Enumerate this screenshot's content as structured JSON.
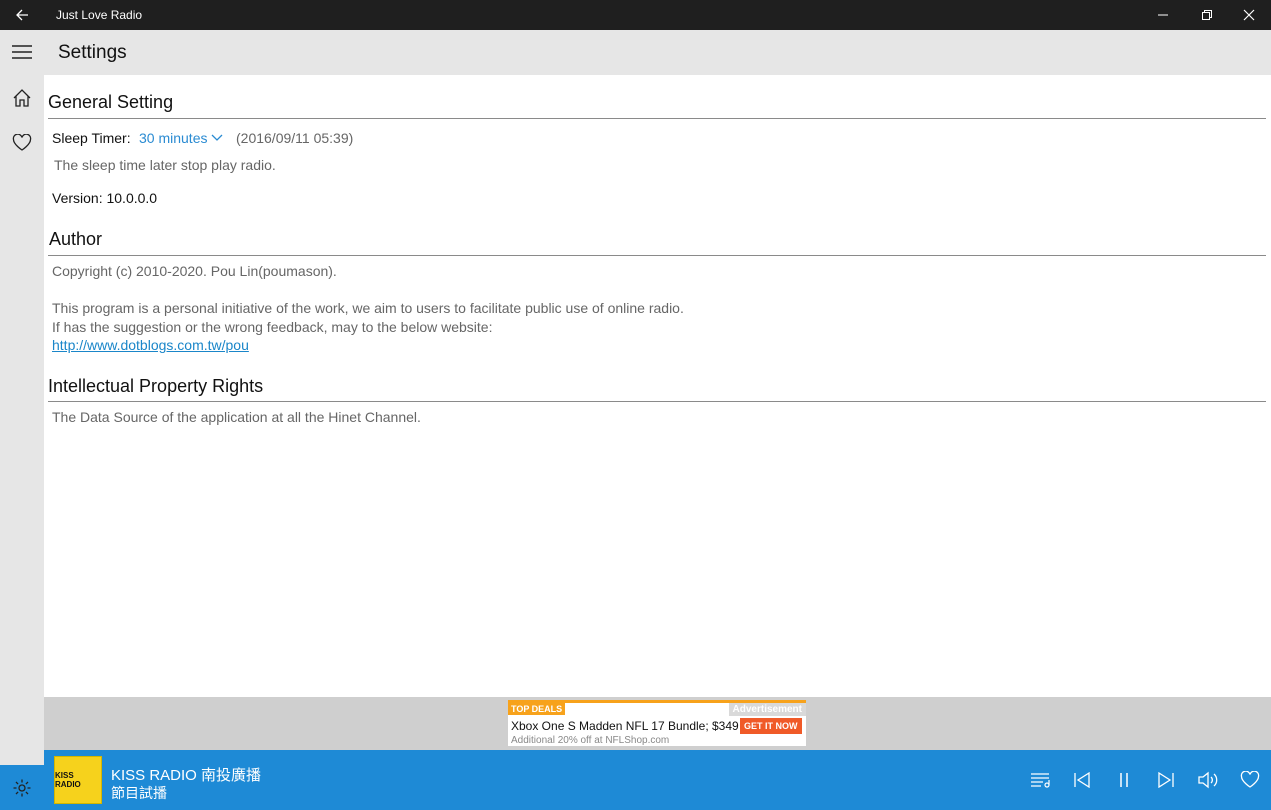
{
  "window": {
    "title": "Just Love Radio"
  },
  "header": {
    "title": "Settings"
  },
  "general": {
    "title": "General Setting",
    "sleep_label": "Sleep Timer:",
    "sleep_value": "30 minutes",
    "sleep_time": "(2016/09/11 05:39)",
    "sleep_desc": "The sleep time later stop play radio.",
    "version": "Version: 10.0.0.0"
  },
  "author": {
    "title": "Author",
    "copyright": "Copyright (c) 2010-2020. Pou Lin(poumason).",
    "line1": "This program is a personal initiative of the work, we aim to users to facilitate public use of online radio.",
    "line2": "If has the suggestion or the wrong feedback, may to the below website:",
    "link": "http://www.dotblogs.com.tw/pou"
  },
  "ipr": {
    "title": "Intellectual Property Rights",
    "text": "The Data Source of the application at all the Hinet Channel."
  },
  "ad": {
    "tag": "TOP DEALS",
    "label": "Advertisement",
    "headline": "Xbox One S Madden NFL 17 Bundle; $349",
    "cta": "GET IT NOW",
    "sub": "Additional 20% off at NFLShop.com"
  },
  "player": {
    "logo_text": "KISS RADIO",
    "station": "KISS RADIO 南投廣播",
    "program": "節目試播"
  },
  "icons": {
    "back": "back-arrow-icon",
    "minimize": "minimize-icon",
    "restore": "restore-icon",
    "close": "close-icon",
    "menu": "hamburger-icon",
    "home": "home-icon",
    "favorite": "heart-icon",
    "settings": "gear-icon",
    "playlist": "playlist-icon",
    "previous": "previous-icon",
    "pause": "pause-icon",
    "next": "next-icon",
    "volume": "volume-icon",
    "like": "heart-icon"
  },
  "colors": {
    "accent": "#1e8ad6",
    "titlebar": "#1f1f1f",
    "ad_orange": "#f7a21b"
  }
}
